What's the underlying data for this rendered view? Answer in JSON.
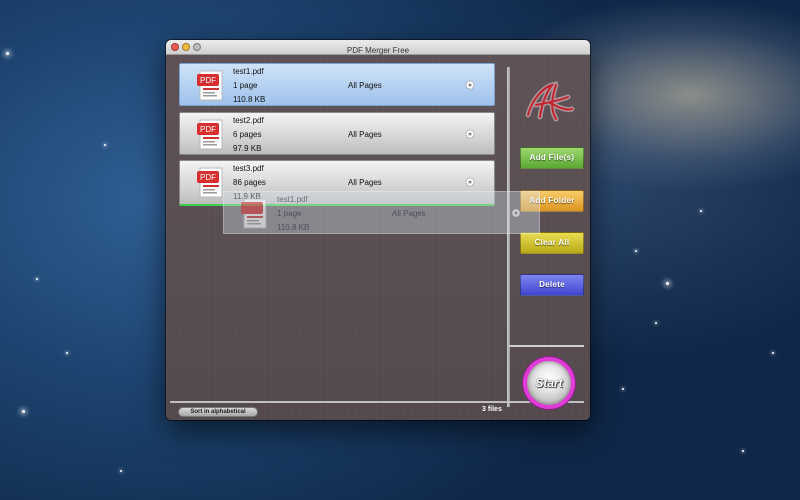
{
  "window": {
    "title": "PDF Merger Free"
  },
  "files": [
    {
      "name": "test1.pdf",
      "pages": "1 page",
      "size": "110.8 KB",
      "range": "All Pages",
      "selected": true
    },
    {
      "name": "test2.pdf",
      "pages": "6 pages",
      "size": "97.9 KB",
      "range": "All Pages",
      "selected": false
    },
    {
      "name": "test3.pdf",
      "pages": "86 pages",
      "size": "11.9 KB",
      "range": "All Pages",
      "selected": false
    }
  ],
  "drag_ghost": {
    "name": "test1.pdf",
    "pages": "1 page",
    "size": "110.8 KB",
    "range": "All Pages"
  },
  "pdf_icon_label": "PDF",
  "actions": {
    "add_files": "Add File(s)",
    "add_folder": "Add Folder",
    "clear_all": "Clear All",
    "delete": "Delete",
    "start": "Start"
  },
  "footer": {
    "sort_label": "Sort in alphabetical",
    "count": "3 files"
  },
  "colors": {
    "selected_row": "#9fc2ec",
    "drop_line": "#3ecf4a",
    "start_ring": "#e03bd6"
  },
  "icons": {
    "row": "pdf-file-icon",
    "gear": "gear-icon",
    "logo": "app-logo-icon"
  }
}
